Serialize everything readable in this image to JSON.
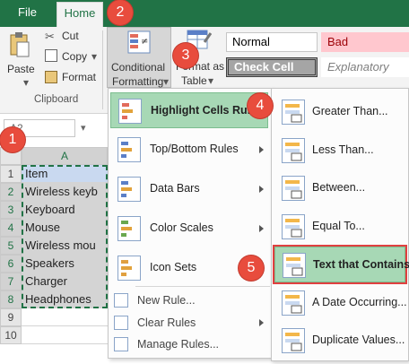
{
  "tabs": {
    "file": "File",
    "home": "Home"
  },
  "clipboard": {
    "paste": "Paste",
    "cut": "Cut",
    "copy": "Copy",
    "format": "Format",
    "group_label": "Clipboard"
  },
  "styles": {
    "conditional_line1": "Conditional",
    "conditional_line2": "Formatting",
    "format_as_line1": "Format as",
    "format_as_line2": "Table",
    "normal": "Normal",
    "bad": "Bad",
    "check_cell": "Check Cell",
    "explanatory": "Explanatory"
  },
  "sheet": {
    "name_box": "A2",
    "column_label": "A",
    "rows": [
      {
        "num": "1",
        "value": "Item"
      },
      {
        "num": "2",
        "value": "Wireless keyb"
      },
      {
        "num": "3",
        "value": "Keyboard"
      },
      {
        "num": "4",
        "value": "Mouse"
      },
      {
        "num": "5",
        "value": "Wireless mou"
      },
      {
        "num": "6",
        "value": "Speakers"
      },
      {
        "num": "7",
        "value": "Charger"
      },
      {
        "num": "8",
        "value": "Headphones"
      },
      {
        "num": "9",
        "value": ""
      },
      {
        "num": "10",
        "value": ""
      }
    ]
  },
  "cf_menu": {
    "items": [
      {
        "label": "Highlight Cells Rules",
        "icon": "highlight-cells-icon"
      },
      {
        "label": "Top/Bottom Rules",
        "icon": "top-bottom-icon"
      },
      {
        "label": "Data Bars",
        "icon": "data-bars-icon"
      },
      {
        "label": "Color Scales",
        "icon": "color-scales-icon"
      },
      {
        "label": "Icon Sets",
        "icon": "icon-sets-icon"
      }
    ],
    "small_items": [
      {
        "label": "New Rule...",
        "icon": "new-rule-icon"
      },
      {
        "label": "Clear Rules",
        "icon": "clear-rules-icon"
      },
      {
        "label": "Manage Rules...",
        "icon": "manage-rules-icon"
      }
    ]
  },
  "submenu": {
    "items": [
      {
        "label": "Greater Than...",
        "icon": "greater-than-icon"
      },
      {
        "label": "Less Than...",
        "icon": "less-than-icon"
      },
      {
        "label": "Between...",
        "icon": "between-icon"
      },
      {
        "label": "Equal To...",
        "icon": "equal-to-icon"
      },
      {
        "label": "Text that Contains...",
        "icon": "text-contains-icon"
      },
      {
        "label": "A Date Occurring...",
        "icon": "date-occurring-icon"
      },
      {
        "label": "Duplicate Values...",
        "icon": "duplicate-values-icon"
      }
    ]
  },
  "callouts": [
    "1",
    "2",
    "3",
    "4",
    "5"
  ],
  "colors": {
    "excel_green": "#217346",
    "callout_red": "#e84c3d",
    "highlight_green": "#a7d8b5",
    "bad_bg": "#ffc7ce",
    "bad_text": "#9c0006",
    "check_cell_bg": "#a5a5a5"
  }
}
